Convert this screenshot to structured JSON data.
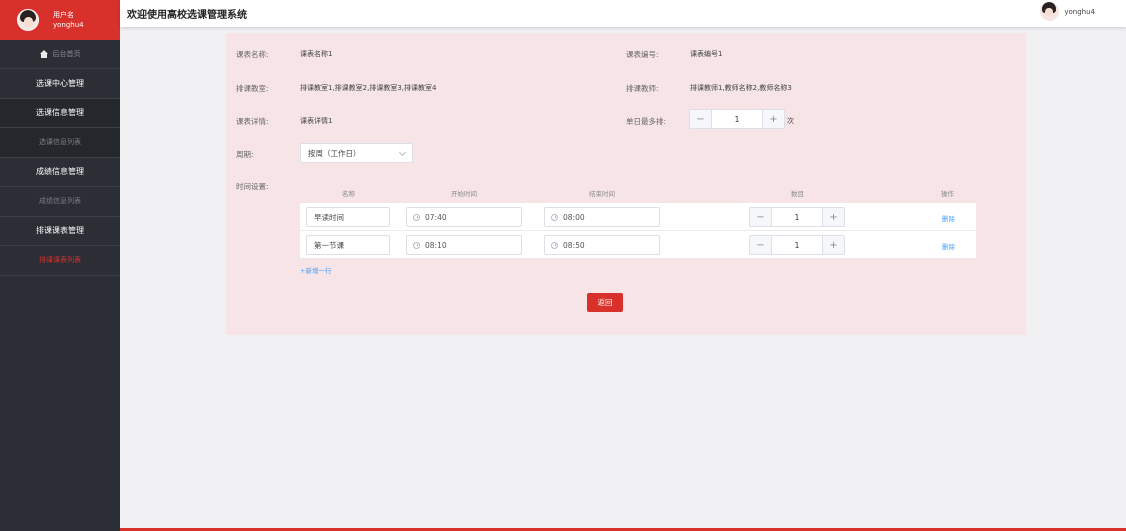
{
  "sidebar": {
    "role": "用户名",
    "username": "yonghu4",
    "home": "后台首页",
    "items": [
      {
        "label": "选课中心管理"
      },
      {
        "label": "选课信息管理"
      },
      {
        "label": "选课信息列表"
      },
      {
        "label": "成绩信息管理"
      },
      {
        "label": "成绩信息列表"
      },
      {
        "label": "排课课表管理"
      },
      {
        "label": "排课课表列表"
      }
    ]
  },
  "header": {
    "title": "欢迎使用高校选课管理系统",
    "username": "yonghu4"
  },
  "form": {
    "course_name_label": "课表名称:",
    "course_name": "课表名称1",
    "course_no_label": "课表编号:",
    "course_no": "课表编号1",
    "classroom_label": "排课教室:",
    "classroom": "排课教室1,排课教室2,排课教室3,排课教室4",
    "teacher_label": "排课教师:",
    "teacher": "排课教师1,教师名称2,教师名称3",
    "detail_label": "课表详情:",
    "detail": "课表详情1",
    "daily_max_label": "单日最多排:",
    "daily_max": "1",
    "daily_max_unit": "次",
    "period_label": "周期:",
    "period": "按周（工作日）",
    "time_label": "时间设置:"
  },
  "table": {
    "headers": {
      "name": "名称",
      "start": "开始时间",
      "end": "结束时间",
      "count": "数目",
      "action": "操作"
    },
    "rows": [
      {
        "name": "早读时间",
        "start": "07:40",
        "end": "08:00",
        "count": "1",
        "action": "删除"
      },
      {
        "name": "第一节课",
        "start": "08:10",
        "end": "08:50",
        "count": "1",
        "action": "删除"
      }
    ],
    "add_row": "+新增一行"
  },
  "buttons": {
    "back": "返回",
    "minus": "−",
    "plus": "+"
  }
}
